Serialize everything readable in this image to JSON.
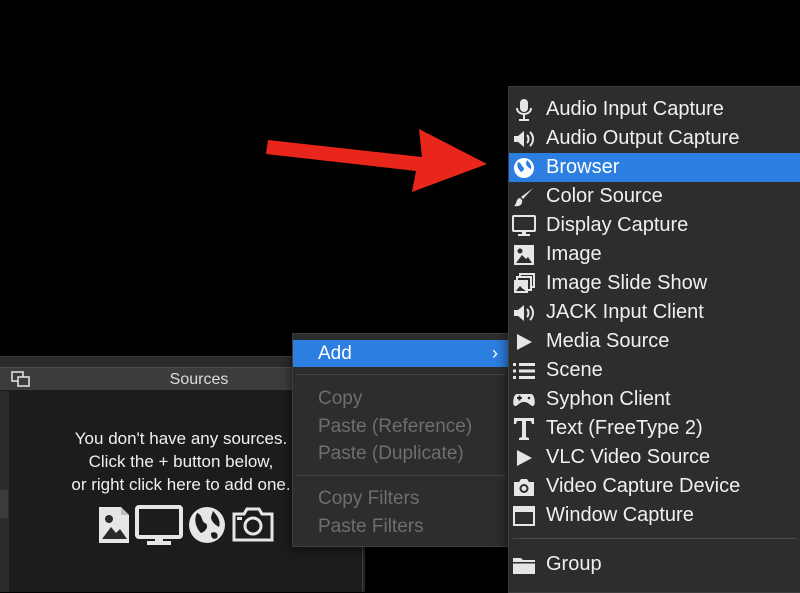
{
  "sources_panel": {
    "title": "Sources",
    "hint_lines": [
      "You don't have any sources.",
      "Click the + button below,",
      "or right click here to add one."
    ],
    "icons": [
      "image-icon",
      "display-icon",
      "globe-icon",
      "camera-icon"
    ]
  },
  "context_menu": {
    "items": [
      {
        "label": "Add",
        "enabled": true,
        "highlighted": true,
        "has_submenu": true
      },
      {
        "label": "Copy",
        "enabled": false
      },
      {
        "label": "Paste (Reference)",
        "enabled": false
      },
      {
        "label": "Paste (Duplicate)",
        "enabled": false
      },
      {
        "label": "Copy Filters",
        "enabled": false
      },
      {
        "label": "Paste Filters",
        "enabled": false
      }
    ],
    "submenu_chevron": "›"
  },
  "add_submenu": {
    "items": [
      {
        "label": "Audio Input Capture",
        "icon": "microphone-icon"
      },
      {
        "label": "Audio Output Capture",
        "icon": "speaker-icon"
      },
      {
        "label": "Browser",
        "icon": "globe-icon",
        "highlighted": true
      },
      {
        "label": "Color Source",
        "icon": "brush-icon"
      },
      {
        "label": "Display Capture",
        "icon": "monitor-icon"
      },
      {
        "label": "Image",
        "icon": "image-icon"
      },
      {
        "label": "Image Slide Show",
        "icon": "slideshow-icon"
      },
      {
        "label": "JACK Input Client",
        "icon": "speaker-icon"
      },
      {
        "label": "Media Source",
        "icon": "play-icon"
      },
      {
        "label": "Scene",
        "icon": "list-icon"
      },
      {
        "label": "Syphon Client",
        "icon": "gamepad-icon"
      },
      {
        "label": "Text (FreeType 2)",
        "icon": "text-icon"
      },
      {
        "label": "VLC Video Source",
        "icon": "play-icon"
      },
      {
        "label": "Video Capture Device",
        "icon": "camera-icon"
      },
      {
        "label": "Window Capture",
        "icon": "window-icon"
      },
      {
        "label": "Group",
        "icon": "folder-icon"
      }
    ]
  },
  "colors": {
    "highlight": "#2d7ee1",
    "menu_bg": "#2d2d2d",
    "arrow": "#e8261b"
  }
}
